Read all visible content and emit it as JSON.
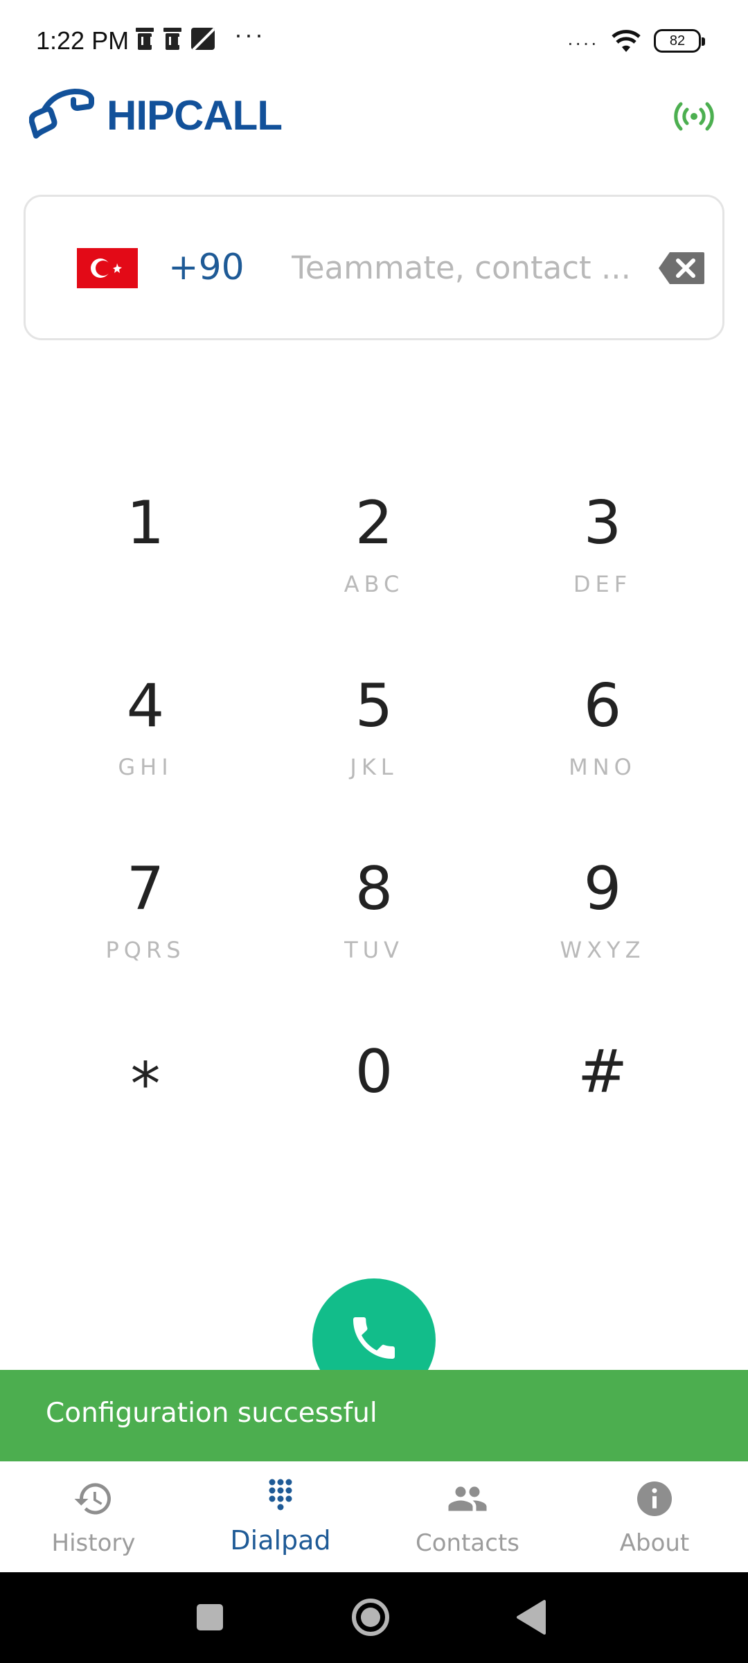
{
  "status_bar": {
    "time": "1:22 PM",
    "notification_icons": [
      "trash-icon",
      "trash-icon",
      "image-off-icon"
    ],
    "overflow": "···",
    "battery_level": "82"
  },
  "header": {
    "brand_name": "HIPCALL",
    "brand_color": "#12519a",
    "connection_status_color": "#4caf50"
  },
  "dial_input": {
    "country_flag": "turkey-flag",
    "country_code": "+90",
    "value": "",
    "placeholder": "Teammate, contact ..."
  },
  "keypad": {
    "keys": [
      {
        "digit": "1",
        "letters": ""
      },
      {
        "digit": "2",
        "letters": "ABC"
      },
      {
        "digit": "3",
        "letters": "DEF"
      },
      {
        "digit": "4",
        "letters": "GHI"
      },
      {
        "digit": "5",
        "letters": "JKL"
      },
      {
        "digit": "6",
        "letters": "MNO"
      },
      {
        "digit": "7",
        "letters": "PQRS"
      },
      {
        "digit": "8",
        "letters": "TUV"
      },
      {
        "digit": "9",
        "letters": "WXYZ"
      },
      {
        "digit": "*",
        "letters": ""
      },
      {
        "digit": "0",
        "letters": ""
      },
      {
        "digit": "#",
        "letters": ""
      }
    ]
  },
  "call_button": {
    "color": "#12bd8a"
  },
  "snackbar": {
    "message": "Configuration successful",
    "color": "#4cae4f"
  },
  "bottom_nav": {
    "items": [
      {
        "label": "History",
        "icon": "history-icon",
        "active": false
      },
      {
        "label": "Dialpad",
        "icon": "dialpad-icon",
        "active": true
      },
      {
        "label": "Contacts",
        "icon": "contacts-icon",
        "active": false
      },
      {
        "label": "About",
        "icon": "info-icon",
        "active": false
      }
    ],
    "active_color": "#1e5a96"
  },
  "system_nav": {
    "buttons": [
      "recents-icon",
      "home-icon",
      "back-icon"
    ]
  }
}
